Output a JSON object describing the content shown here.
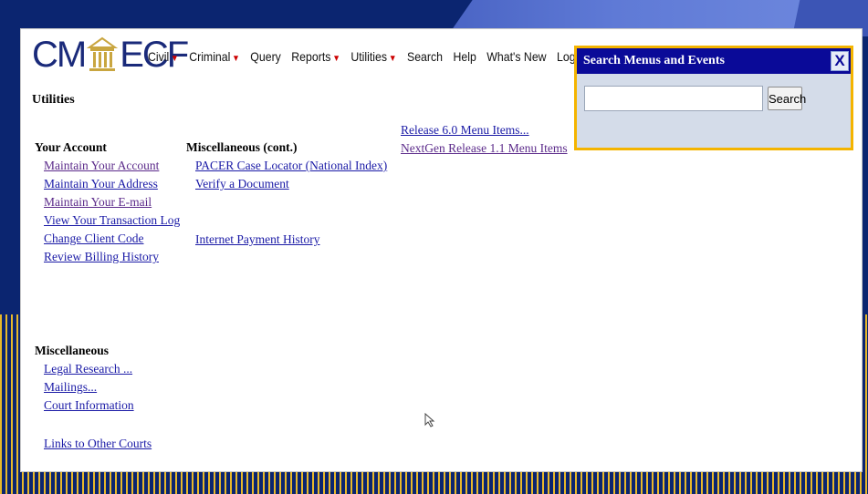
{
  "app": {
    "logo": {
      "left": "CM",
      "right": "ECF"
    },
    "menu": [
      {
        "label": "Civil",
        "has_caret": true
      },
      {
        "label": "Criminal",
        "has_caret": true
      },
      {
        "label": "Query",
        "has_caret": false
      },
      {
        "label": "Reports",
        "has_caret": true
      },
      {
        "label": "Utilities",
        "has_caret": true
      },
      {
        "label": "Search",
        "has_caret": false
      },
      {
        "label": "Help",
        "has_caret": false
      },
      {
        "label": "What's New",
        "has_caret": false
      },
      {
        "label": "Log Ou",
        "has_caret": false
      }
    ]
  },
  "page": {
    "title": "Utilities",
    "your_account": {
      "heading": "Your Account",
      "links": [
        "Maintain Your Account",
        "Maintain Your Address",
        "Maintain Your E-mail",
        "View Your Transaction Log",
        "Change Client Code",
        "Review Billing History"
      ]
    },
    "misc_cont": {
      "heading": "Miscellaneous (cont.)",
      "links_top": [
        "PACER Case Locator (National Index)",
        "Verify a Document"
      ],
      "links_bottom": [
        "Internet Payment History"
      ]
    },
    "release": {
      "links": [
        "Release 6.0 Menu Items...",
        "NextGen Release 1.1 Menu Items"
      ]
    },
    "misc": {
      "heading": "Miscellaneous",
      "links": [
        "Legal Research ...",
        "Mailings...",
        "Court Information"
      ],
      "bottom_link": "Links to Other Courts"
    }
  },
  "search_panel": {
    "title": "Search Menus and Events",
    "close_label": "X",
    "input_value": "",
    "button_label": "Search"
  },
  "colors": {
    "slide_background": "#0b2570",
    "stripe_accent": "#e8b82a",
    "search_header": "#0a0a98",
    "highlight_border": "#f4b400",
    "link": "#1a1aa6"
  }
}
